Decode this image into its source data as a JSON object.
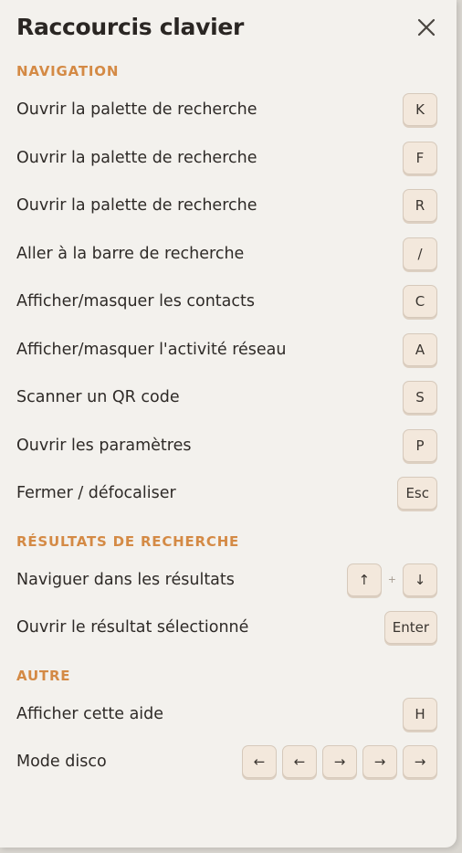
{
  "dialog": {
    "title": "Raccourcis clavier",
    "close_icon": "close-icon"
  },
  "sections": {
    "navigation": {
      "title": "NAVIGATION",
      "rows": [
        {
          "label": "Ouvrir la palette de recherche",
          "keys": [
            "K"
          ]
        },
        {
          "label": "Ouvrir la palette de recherche",
          "keys": [
            "F"
          ]
        },
        {
          "label": "Ouvrir la palette de recherche",
          "keys": [
            "R"
          ]
        },
        {
          "label": "Aller à la barre de recherche",
          "keys": [
            "/"
          ]
        },
        {
          "label": "Afficher/masquer les contacts",
          "keys": [
            "C"
          ]
        },
        {
          "label": "Afficher/masquer l'activité réseau",
          "keys": [
            "A"
          ]
        },
        {
          "label": "Scanner un QR code",
          "keys": [
            "S"
          ]
        },
        {
          "label": "Ouvrir les paramètres",
          "keys": [
            "P"
          ]
        },
        {
          "label": "Fermer / défocaliser",
          "keys": [
            "Esc"
          ]
        }
      ]
    },
    "results": {
      "title": "RÉSULTATS DE RECHERCHE",
      "rows": [
        {
          "label": "Naviguer dans les résultats",
          "keys": [
            "↑",
            "+",
            "↓"
          ]
        },
        {
          "label": "Ouvrir le résultat sélectionné",
          "keys": [
            "Enter"
          ]
        }
      ]
    },
    "other": {
      "title": "AUTRE",
      "rows": [
        {
          "label": "Afficher cette aide",
          "keys": [
            "H"
          ]
        },
        {
          "label": "Mode disco",
          "keys": [
            "←",
            "←",
            "→",
            "→",
            "→"
          ]
        }
      ]
    }
  },
  "colors": {
    "accent": "#d48a45",
    "panel_bg": "#f3f1ed",
    "key_bg": "#f3e8dc",
    "text": "#2e2a27"
  }
}
